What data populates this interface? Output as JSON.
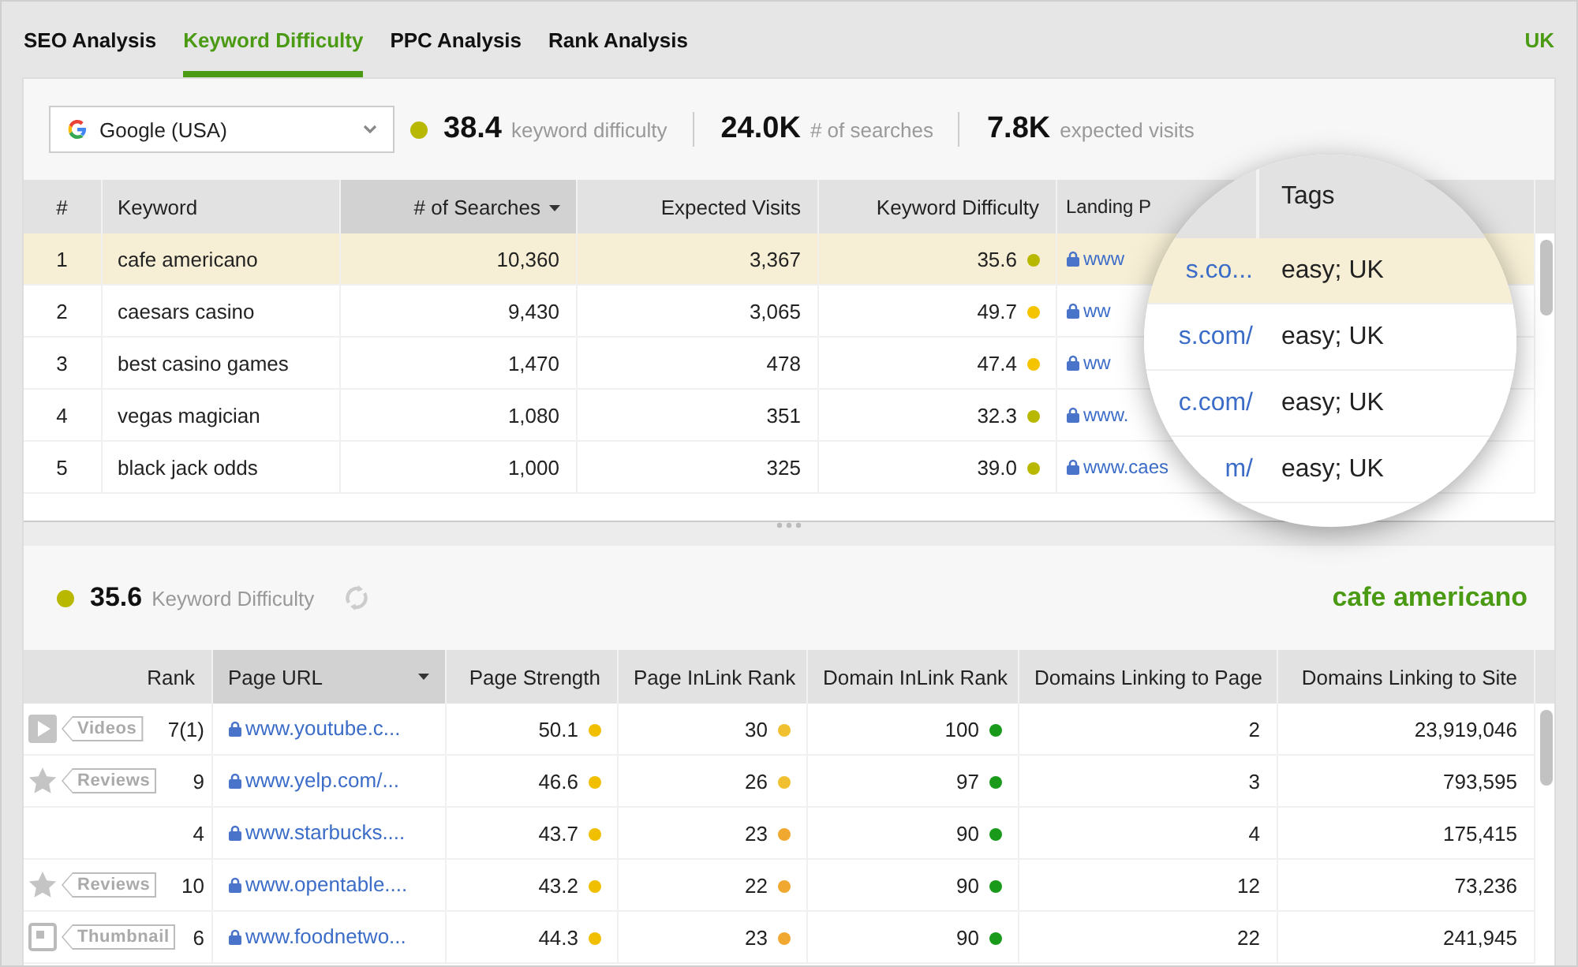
{
  "tabs": [
    {
      "label": "SEO Analysis",
      "selected": false
    },
    {
      "label": "Keyword Difficulty",
      "selected": true
    },
    {
      "label": "PPC Analysis",
      "selected": false
    },
    {
      "label": "Rank Analysis",
      "selected": false
    }
  ],
  "region": "UK",
  "engine_select": {
    "value": "Google (USA)"
  },
  "stats": [
    {
      "value": "38.4",
      "label": "keyword difficulty",
      "color": "#b8b800"
    },
    {
      "value": "24.0K",
      "label": "# of searches"
    },
    {
      "value": "7.8K",
      "label": "expected visits"
    }
  ],
  "keywords_table": {
    "columns": [
      {
        "label": "#",
        "sorted": false
      },
      {
        "label": "Keyword",
        "sorted": false
      },
      {
        "label": "# of Searches",
        "sorted": true
      },
      {
        "label": "Expected Visits",
        "sorted": false
      },
      {
        "label": "Keyword Difficulty",
        "sorted": false
      },
      {
        "label": "Landing P",
        "sorted": false
      }
    ],
    "rows": [
      {
        "num": "1",
        "keyword": "cafe americano",
        "searches": "10,360",
        "visits": "3,367",
        "difficulty": {
          "value": "35.6",
          "color": "#b8b800"
        },
        "landing": "www",
        "selected": true
      },
      {
        "num": "2",
        "keyword": "caesars casino",
        "searches": "9,430",
        "visits": "3,065",
        "difficulty": {
          "value": "49.7",
          "color": "#f5c400"
        },
        "landing": "ww",
        "selected": false
      },
      {
        "num": "3",
        "keyword": "best casino games",
        "searches": "1,470",
        "visits": "478",
        "difficulty": {
          "value": "47.4",
          "color": "#f5c400"
        },
        "landing": "ww",
        "selected": false
      },
      {
        "num": "4",
        "keyword": "vegas magician",
        "searches": "1,080",
        "visits": "351",
        "difficulty": {
          "value": "32.3",
          "color": "#b8b800"
        },
        "landing": "www.",
        "selected": false
      },
      {
        "num": "5",
        "keyword": "black jack odds",
        "searches": "1,000",
        "visits": "325",
        "difficulty": {
          "value": "39.0",
          "color": "#b8b800"
        },
        "landing": "www.caes",
        "selected": false
      }
    ]
  },
  "magnifier": {
    "header": "Tags",
    "rows": [
      {
        "url": "s.co...",
        "tags": "easy; UK",
        "selected": true
      },
      {
        "url": "s.com/",
        "tags": "easy; UK",
        "selected": false
      },
      {
        "url": "c.com/",
        "tags": "easy; UK",
        "selected": false
      },
      {
        "url": "m/",
        "tags": "easy; UK",
        "selected": false
      }
    ]
  },
  "summary": {
    "value": "35.6",
    "label": "Keyword Difficulty",
    "color": "#b8b800",
    "keyword": "cafe americano"
  },
  "serp_table": {
    "columns": [
      {
        "label": "Rank",
        "sorted": false
      },
      {
        "label": "Page URL",
        "sorted": true
      },
      {
        "label": "Page Strength",
        "sorted": false
      },
      {
        "label": "Page InLink Rank",
        "sorted": false
      },
      {
        "label": "Domain InLink Rank",
        "sorted": false
      },
      {
        "label": "Domains Linking to Page",
        "sorted": false
      },
      {
        "label": "Domains Linking to Site",
        "sorted": false
      }
    ],
    "rows": [
      {
        "kind": "video",
        "badge": "Videos",
        "rank": "7(1)",
        "url": "www.youtube.c...",
        "strength": {
          "value": "50.1",
          "color": "#f0c000"
        },
        "page_rank": {
          "value": "30",
          "color": "#f0c030"
        },
        "domain_rank": {
          "value": "100",
          "color": "#1a9a1a"
        },
        "domains_page": "2",
        "domains_site": "23,919,046"
      },
      {
        "kind": "reviews",
        "badge": "Reviews",
        "rank": "9",
        "url": "www.yelp.com/...",
        "strength": {
          "value": "46.6",
          "color": "#f0c000"
        },
        "page_rank": {
          "value": "26",
          "color": "#f0c030"
        },
        "domain_rank": {
          "value": "97",
          "color": "#1a9a1a"
        },
        "domains_page": "3",
        "domains_site": "793,595"
      },
      {
        "kind": "plain",
        "rank": "4",
        "url": "www.starbucks....",
        "strength": {
          "value": "43.7",
          "color": "#f0c000"
        },
        "page_rank": {
          "value": "23",
          "color": "#f0a830"
        },
        "domain_rank": {
          "value": "90",
          "color": "#1a9a1a"
        },
        "domains_page": "4",
        "domains_site": "175,415"
      },
      {
        "kind": "reviews",
        "badge": "Reviews",
        "rank": "10",
        "url": "www.opentable....",
        "strength": {
          "value": "43.2",
          "color": "#f0c000"
        },
        "page_rank": {
          "value": "22",
          "color": "#f0a830"
        },
        "domain_rank": {
          "value": "90",
          "color": "#1a9a1a"
        },
        "domains_page": "12",
        "domains_site": "73,236"
      },
      {
        "kind": "thumbnail",
        "badge": "Thumbnail",
        "rank": "6",
        "url": "www.foodnetwo...",
        "strength": {
          "value": "44.3",
          "color": "#f0c000"
        },
        "page_rank": {
          "value": "23",
          "color": "#f0a830"
        },
        "domain_rank": {
          "value": "90",
          "color": "#1a9a1a"
        },
        "domains_page": "22",
        "domains_site": "241,945"
      }
    ]
  }
}
